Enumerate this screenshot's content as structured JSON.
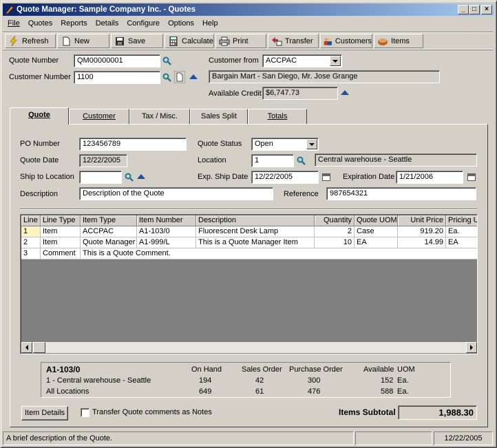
{
  "window": {
    "title": "Quote Manager: Sample Company Inc. - Quotes"
  },
  "menu": [
    "File",
    "Quotes",
    "Reports",
    "Details",
    "Configure",
    "Options",
    "Help"
  ],
  "toolbar": {
    "refresh": "Refresh",
    "new": "New",
    "save": "Save",
    "calculate": "Calculate",
    "print": "Print",
    "transfer": "Transfer",
    "customers": "Customers",
    "items": "Items"
  },
  "header": {
    "quote_number_label": "Quote Number",
    "quote_number": "QM00000001",
    "customer_number_label": "Customer Number",
    "customer_number": "1100",
    "customer_from_label": "Customer from",
    "customer_from": "ACCPAC",
    "customer_name": "Bargain Mart - San Diego, Mr. Jose Grange",
    "available_credit_label": "Available Credit",
    "available_credit": "$6,747.73"
  },
  "tabs": [
    "Quote",
    "Customer",
    "Tax / Misc.",
    "Sales Split",
    "Totals"
  ],
  "quote": {
    "po_number_label": "PO Number",
    "po_number": "123456789",
    "quote_status_label": "Quote Status",
    "quote_status": "Open",
    "quote_date_label": "Quote Date",
    "quote_date": "12/22/2005",
    "location_label": "Location",
    "location": "1",
    "location_desc": "Central warehouse - Seattle",
    "ship_to_label": "Ship to Location",
    "ship_to": "",
    "exp_ship_date_label": "Exp. Ship Date",
    "exp_ship_date": "12/22/2005",
    "expiration_date_label": "Expiration Date",
    "expiration_date": "1/21/2006",
    "description_label": "Description",
    "description": "Description of the Quote",
    "reference_label": "Reference",
    "reference": "987654321"
  },
  "grid": {
    "columns": [
      "Line",
      "Line Type",
      "Item Type",
      "Item Number",
      "Description",
      "Quantity",
      "Quote UOM",
      "Unit Price",
      "Pricing UOM"
    ],
    "rows": [
      {
        "line": "1",
        "line_type": "Item",
        "item_type": "ACCPAC",
        "item_number": "A1-103/0",
        "description": "Fluorescent Desk Lamp",
        "quantity": "2",
        "uom": "Case",
        "unit_price": "919.20",
        "pricing_uom": "Ea."
      },
      {
        "line": "2",
        "line_type": "Item",
        "item_type": "Quote Manager",
        "item_number": "A1-999/L",
        "description": "This is a Quote Manager Item",
        "quantity": "10",
        "uom": "EA",
        "unit_price": "14.99",
        "pricing_uom": "EA"
      },
      {
        "line": "3",
        "line_type": "Comment",
        "comment": "This is a Quote Comment."
      }
    ]
  },
  "availability": {
    "item": "A1-103/0",
    "headers": [
      "On Hand",
      "Sales Order",
      "Purchase Order",
      "Available",
      "UOM"
    ],
    "rows": [
      {
        "label": "1 - Central warehouse - Seattle",
        "on_hand": "194",
        "sales_order": "42",
        "purchase_order": "300",
        "available": "152",
        "uom": "Ea."
      },
      {
        "label": "All Locations",
        "on_hand": "649",
        "sales_order": "61",
        "purchase_order": "476",
        "available": "588",
        "uom": "Ea."
      }
    ]
  },
  "footer": {
    "item_details": "Item Details",
    "transfer_comments": "Transfer Quote comments as Notes",
    "items_subtotal_label": "Items Subtotal",
    "items_subtotal": "1,988.30"
  },
  "status": {
    "message": "A brief description of the Quote.",
    "date": "12/22/2005"
  }
}
